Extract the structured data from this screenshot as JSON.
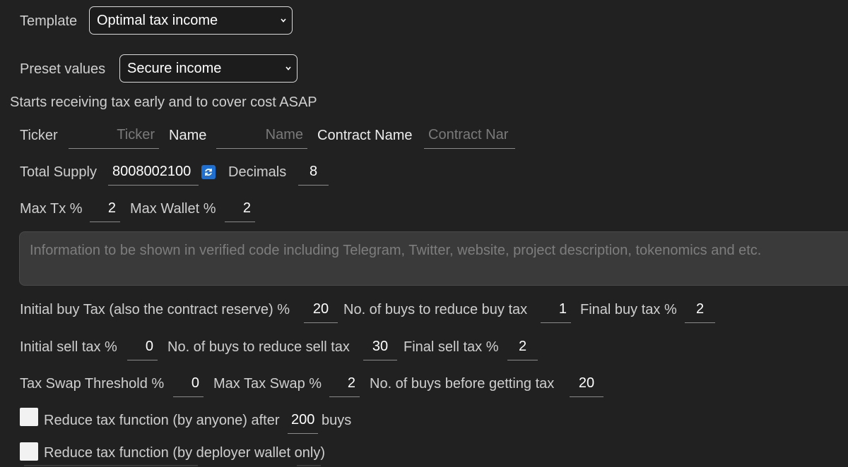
{
  "template": {
    "label": "Template",
    "value": "Optimal tax income"
  },
  "preset": {
    "label": "Preset values",
    "value": "Secure income"
  },
  "description": "Starts receiving tax early and to cover cost ASAP",
  "token": {
    "ticker_label": "Ticker",
    "ticker_placeholder": "Ticker",
    "name_label": "Name",
    "name_placeholder": "Name",
    "contract_name_label": "Contract Name",
    "contract_name_placeholder": "Contract Nar",
    "total_supply_label": "Total Supply",
    "total_supply_value": "8008002100",
    "refresh_icon": "refresh-icon",
    "decimals_label": "Decimals",
    "decimals_value": "8",
    "max_tx_label": "Max Tx %",
    "max_tx_value": "2",
    "max_wallet_label": "Max Wallet %",
    "max_wallet_value": "2"
  },
  "info_placeholder": "Information to be shown in verified code including Telegram, Twitter, website, project description, tokenomics and etc.",
  "tax": {
    "initial_buy_label": "Initial buy Tax (also the contract reserve) %",
    "initial_buy_value": "20",
    "buys_reduce_buy_label": "No. of buys to reduce buy tax",
    "buys_reduce_buy_value": "1",
    "final_buy_label": "Final buy tax %",
    "final_buy_value": "2",
    "initial_sell_label": "Initial sell tax %",
    "initial_sell_value": "0",
    "buys_reduce_sell_label": "No. of buys to reduce sell tax",
    "buys_reduce_sell_value": "30",
    "final_sell_label": "Final sell tax %",
    "final_sell_value": "2",
    "swap_threshold_label": "Tax Swap Threshold %",
    "swap_threshold_value": "0",
    "max_swap_label": "Max Tax Swap %",
    "max_swap_value": "2",
    "buys_before_tax_label": "No. of buys before getting tax",
    "buys_before_tax_value": "20"
  },
  "options": {
    "reduce_anyone_label": "Reduce tax function (by anyone) after",
    "reduce_anyone_value": "200",
    "reduce_anyone_suffix": "buys",
    "reduce_deployer_label": "Reduce tax function (by deployer wallet only)"
  },
  "colors": {
    "background": "#212121",
    "accent": "#1f6fd1",
    "textarea_bg": "#3a3a3a"
  }
}
